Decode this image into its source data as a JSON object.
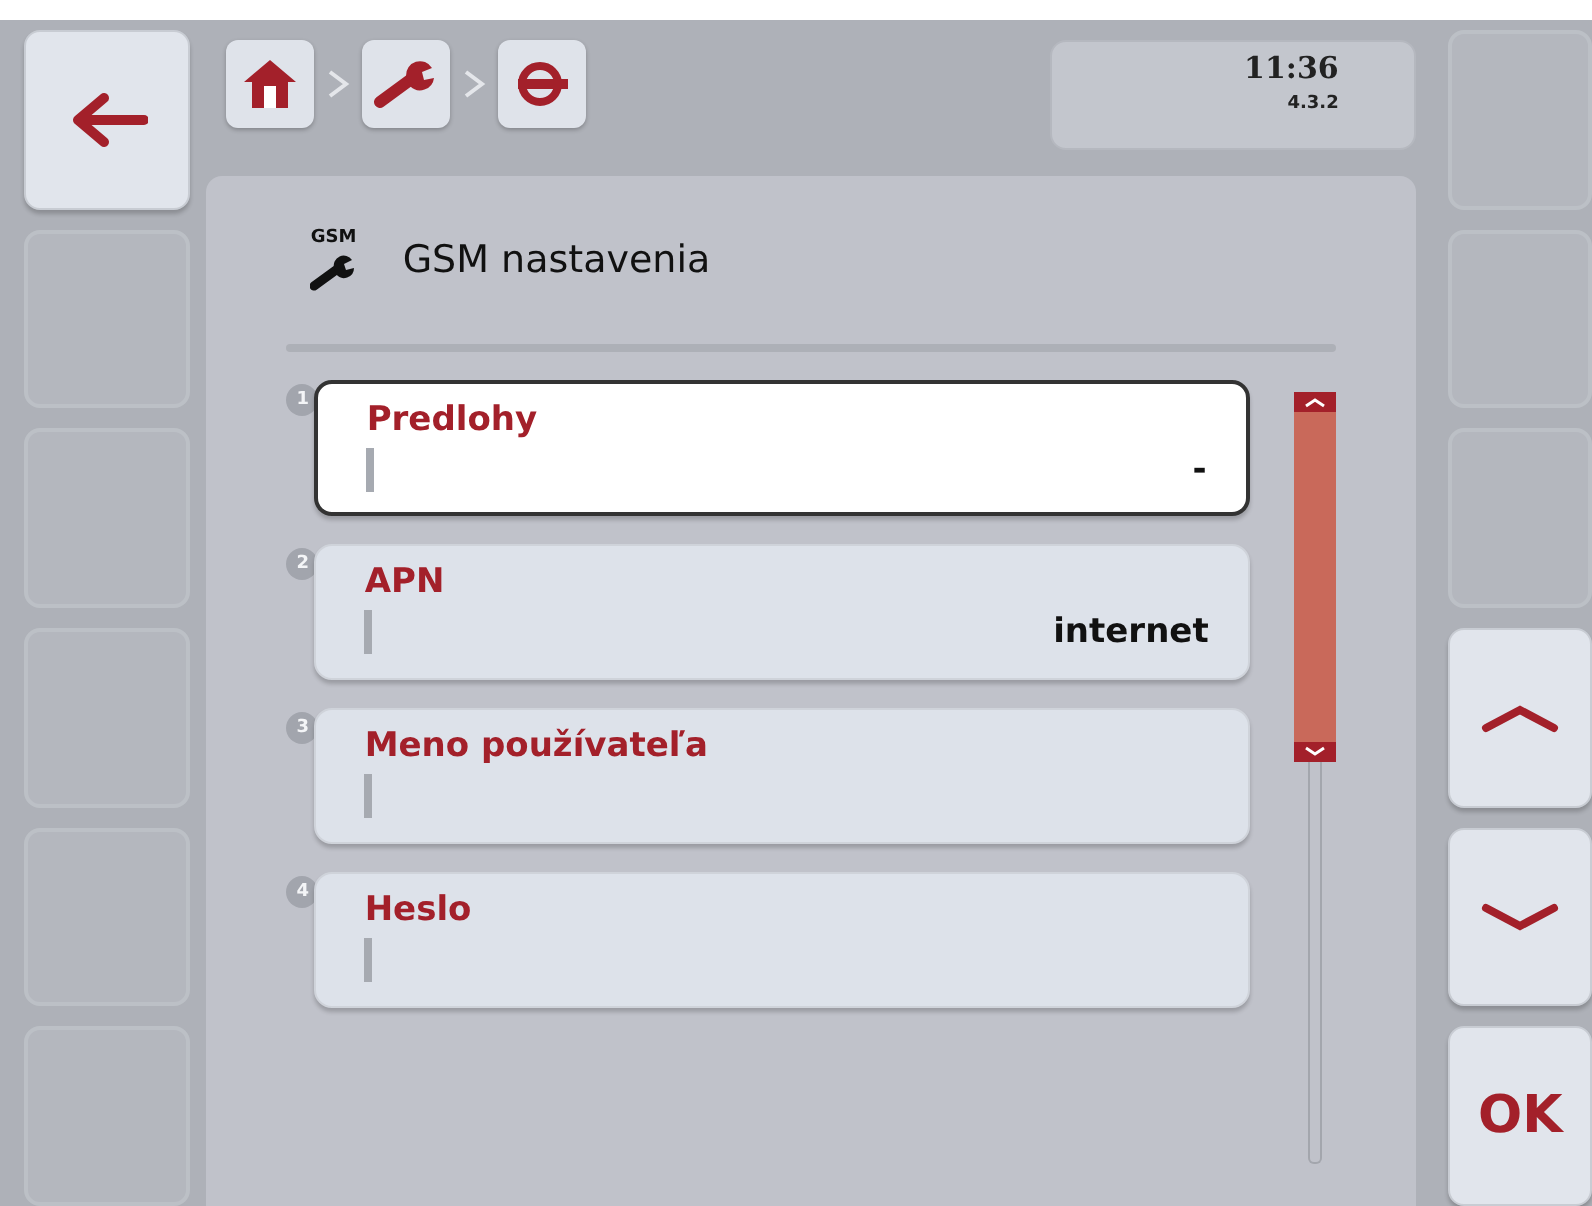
{
  "header": {
    "time": "11:36",
    "version": "4.3.2"
  },
  "breadcrumb": [
    {
      "kind": "home"
    },
    {
      "kind": "wrench"
    },
    {
      "kind": "plug"
    }
  ],
  "title": {
    "icon_label": "GSM",
    "text": "GSM nastavenia"
  },
  "items": [
    {
      "number": "1",
      "label": "Predlohy",
      "value": "-",
      "selected": true
    },
    {
      "number": "2",
      "label": "APN",
      "value": "internet",
      "selected": false
    },
    {
      "number": "3",
      "label": "Meno používateľa",
      "selected": false
    },
    {
      "number": "4",
      "label": "Heslo",
      "selected": false
    }
  ],
  "left_softkeys": [
    {
      "kind": "back"
    },
    {
      "kind": "empty"
    },
    {
      "kind": "empty"
    },
    {
      "kind": "empty"
    },
    {
      "kind": "empty"
    },
    {
      "kind": "empty"
    }
  ],
  "right_softkeys": [
    {
      "kind": "empty"
    },
    {
      "kind": "empty"
    },
    {
      "kind": "empty"
    },
    {
      "kind": "up"
    },
    {
      "kind": "down"
    },
    {
      "kind": "ok",
      "label": "OK"
    }
  ]
}
